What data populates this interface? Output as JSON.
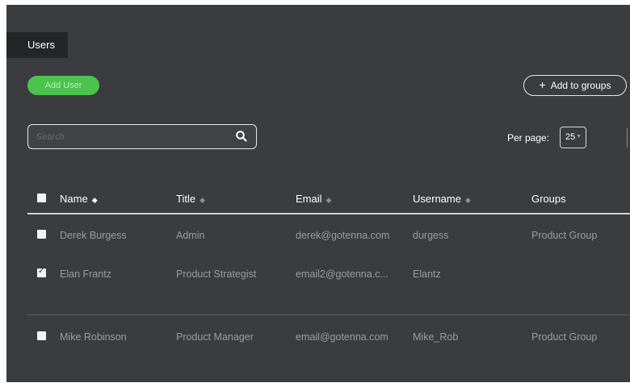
{
  "tab": {
    "label": "Users"
  },
  "actions": {
    "add_user_label": "Add User",
    "add_groups_label": "Add to groups",
    "add_groups_icon": "plus-icon"
  },
  "search": {
    "placeholder": "Search",
    "value": "",
    "icon": "search-icon"
  },
  "pagination": {
    "per_page_label": "Per page:",
    "per_page_value": "25"
  },
  "table": {
    "columns": [
      {
        "label": "Name",
        "sortable": true,
        "sort_active": true
      },
      {
        "label": "Title",
        "sortable": true,
        "sort_active": false
      },
      {
        "label": "Email",
        "sortable": true,
        "sort_active": false
      },
      {
        "label": "Username",
        "sortable": true,
        "sort_active": false
      },
      {
        "label": "Groups",
        "sortable": false,
        "sort_active": false
      }
    ],
    "select_all_checked": false,
    "rows": [
      {
        "checked": false,
        "name": "Derek Burgess",
        "title": "Admin",
        "email": "derek@gotenna.com",
        "username": "durgess",
        "groups": "Product Group"
      },
      {
        "checked": true,
        "name": "Elan Frantz",
        "title": "Product Strategist",
        "email": "email2@gotenna.c...",
        "username": "Elantz",
        "groups": ""
      },
      {
        "checked": false,
        "name": "Mike Robinson",
        "title": "Product Manager",
        "email": "email@gotenna.com",
        "username": "Mike_Rob",
        "groups": "Product Group"
      }
    ]
  },
  "colors": {
    "background": "#3a3c3f",
    "tab_background": "#232527",
    "accent_green": "#4cc24f",
    "text_primary": "#ffffff",
    "text_muted": "#9a9da1"
  }
}
